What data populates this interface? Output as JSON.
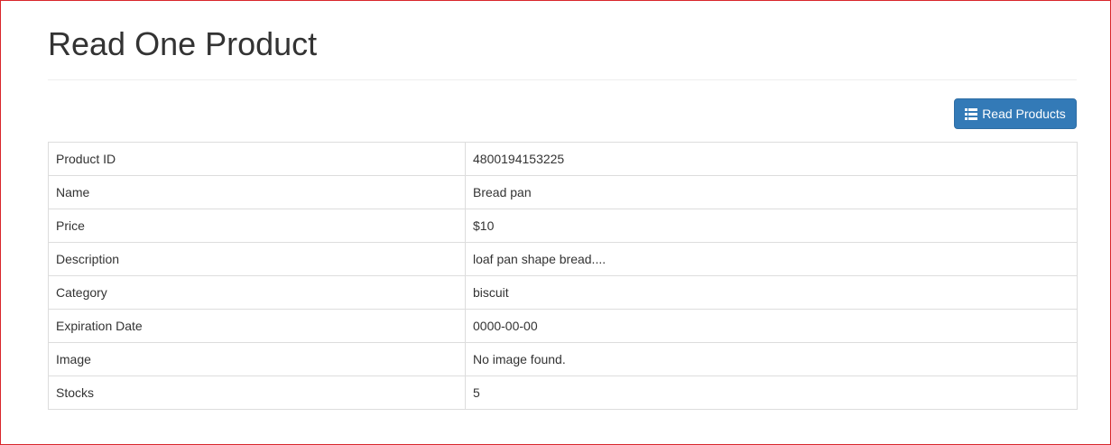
{
  "page": {
    "title": "Read One Product"
  },
  "toolbar": {
    "read_products_label": "Read Products",
    "read_products_icon": "list-icon",
    "button_color": "#337ab7"
  },
  "product": {
    "rows": [
      {
        "label": "Product ID",
        "value": "4800194153225"
      },
      {
        "label": "Name",
        "value": "Bread pan"
      },
      {
        "label": "Price",
        "value": "$10"
      },
      {
        "label": "Description",
        "value": "loaf pan shape bread...."
      },
      {
        "label": "Category",
        "value": "biscuit"
      },
      {
        "label": "Expiration Date",
        "value": "0000-00-00"
      },
      {
        "label": "Image",
        "value": "No image found."
      },
      {
        "label": "Stocks",
        "value": "5"
      }
    ]
  }
}
